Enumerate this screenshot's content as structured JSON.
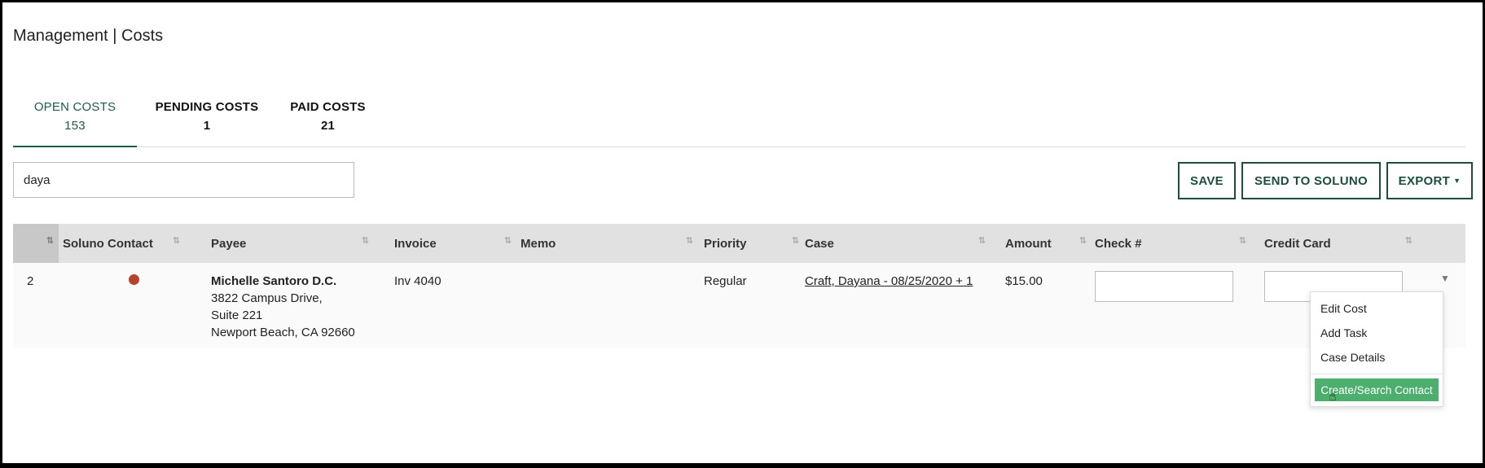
{
  "header": {
    "title": "Management | Costs"
  },
  "tabs": [
    {
      "label": "OPEN COSTS",
      "count": "153",
      "active": true
    },
    {
      "label": "PENDING COSTS",
      "count": "1"
    },
    {
      "label": "PAID COSTS",
      "count": "21"
    }
  ],
  "search": {
    "value": "daya"
  },
  "toolbar": {
    "save_label": "SAVE",
    "send_label": "SEND TO SOLUNO",
    "export_label": "EXPORT"
  },
  "table": {
    "columns": [
      "Soluno Contact",
      "Payee",
      "Invoice",
      "Memo",
      "Priority",
      "Case",
      "Amount",
      "Check #",
      "Credit Card"
    ],
    "rows": [
      {
        "num": "2",
        "payee_name": "Michelle Santoro D.C.",
        "payee_address1": "3822 Campus Drive,",
        "payee_address2": "Suite 221",
        "payee_address3": "Newport Beach, CA 92660",
        "invoice": "Inv 4040",
        "memo": "",
        "priority": "Regular",
        "case": "Craft, Dayana - 08/25/2020 + 1",
        "amount": "$15.00",
        "check": "",
        "credit_card": ""
      }
    ]
  },
  "row_menu": {
    "items": [
      "Edit Cost",
      "Add Task",
      "Case Details"
    ],
    "primary": "Create/Search Contact"
  },
  "colors": {
    "accent": "#1e5a4c",
    "primary_action": "#4caf6e",
    "status_dot": "#b7432a"
  }
}
